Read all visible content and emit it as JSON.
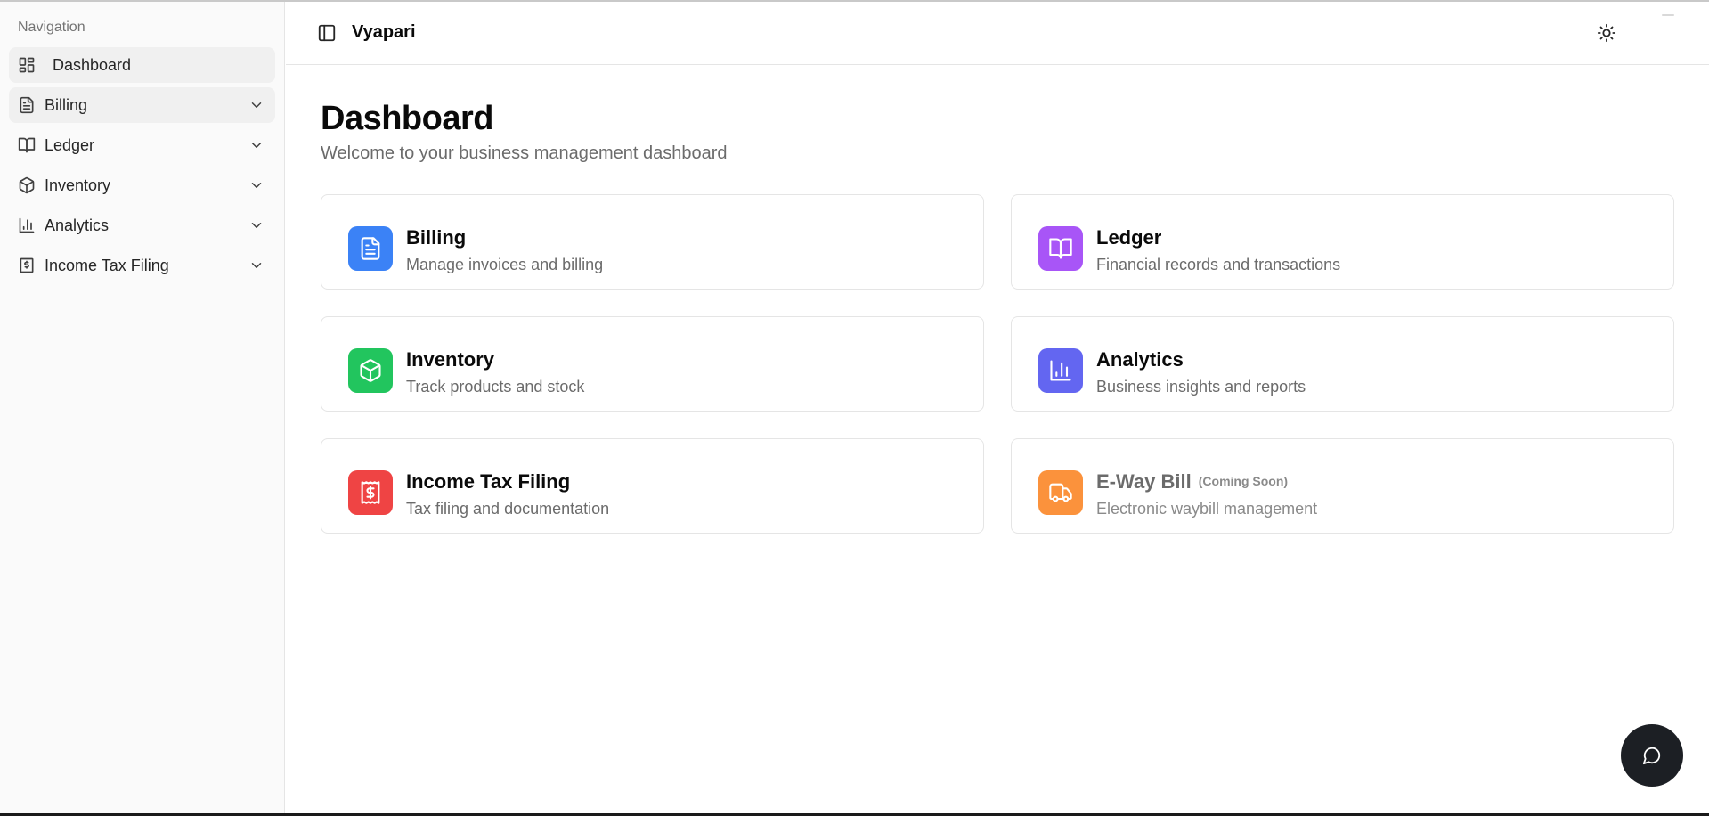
{
  "sidebar": {
    "heading": "Navigation",
    "items": [
      {
        "label": "Dashboard",
        "icon": "layout-dashboard-icon",
        "active": true,
        "expandable": false
      },
      {
        "label": "Billing",
        "icon": "file-text-icon",
        "active": false,
        "expandable": true
      },
      {
        "label": "Ledger",
        "icon": "book-open-icon",
        "active": false,
        "expandable": true
      },
      {
        "label": "Inventory",
        "icon": "package-icon",
        "active": false,
        "expandable": true
      },
      {
        "label": "Analytics",
        "icon": "bar-chart-icon",
        "active": false,
        "expandable": true
      },
      {
        "label": "Income Tax Filing",
        "icon": "receipt-icon",
        "active": false,
        "expandable": true
      }
    ]
  },
  "header": {
    "title": "Vyapari",
    "sidebar_toggle_icon": "panel-left-icon",
    "theme_toggle_icon": "sun-icon"
  },
  "main": {
    "title": "Dashboard",
    "subtitle": "Welcome to your business management dashboard",
    "cards": [
      {
        "title": "Billing",
        "description": "Manage invoices and billing",
        "icon": "file-text-icon",
        "color": "#3b82f6"
      },
      {
        "title": "Ledger",
        "description": "Financial records and transactions",
        "icon": "book-open-icon",
        "color": "#a855f7"
      },
      {
        "title": "Inventory",
        "description": "Track products and stock",
        "icon": "package-icon",
        "color": "#22c55e"
      },
      {
        "title": "Analytics",
        "description": "Business insights and reports",
        "icon": "bar-chart-icon",
        "color": "#6366f1"
      },
      {
        "title": "Income Tax Filing",
        "description": "Tax filing and documentation",
        "icon": "receipt-icon",
        "color": "#ef4444"
      },
      {
        "title": "E-Way Bill",
        "badge": "(Coming Soon)",
        "description": "Electronic waybill management",
        "icon": "truck-icon",
        "color": "#fb923c",
        "disabled": true
      }
    ]
  },
  "chat": {
    "icon": "message-circle-icon",
    "color": "#1c1f24"
  }
}
